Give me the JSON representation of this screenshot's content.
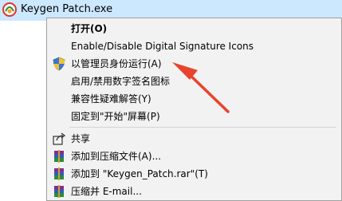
{
  "file": {
    "name": "Keygen Patch.exe",
    "icon": "keygen-app-icon"
  },
  "menu": {
    "items": [
      {
        "label": "打开(O)",
        "bold": true,
        "icon": ""
      },
      {
        "label": "Enable/Disable Digital Signature Icons",
        "icon": ""
      },
      {
        "label": "以管理员身份运行(A)",
        "icon": "shield-icon"
      },
      {
        "label": "启用/禁用数字签名图标",
        "icon": ""
      },
      {
        "label": "兼容性疑难解答(Y)",
        "icon": ""
      },
      {
        "label": "固定到\"开始\"屏幕(P)",
        "icon": ""
      },
      {
        "label": "共享",
        "icon": "share-icon"
      },
      {
        "label": "添加到压缩文件(A)...",
        "icon": "winrar-icon"
      },
      {
        "label": "添加到 \"Keygen_Patch.rar\"(T)",
        "icon": "winrar-icon"
      },
      {
        "label": "压缩并 E-mail...",
        "icon": "winrar-icon"
      }
    ]
  },
  "annotation": {
    "arrow_color": "#e8432d"
  }
}
